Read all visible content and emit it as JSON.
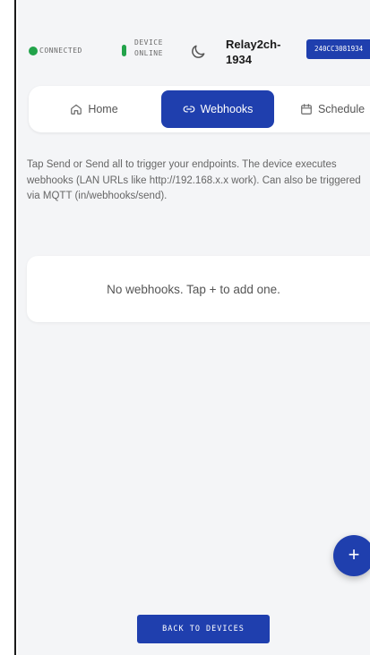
{
  "status": {
    "connected_label": "CONNECTED",
    "device_online_line1": "DEVICE",
    "device_online_line2": "ONLINE",
    "device_name_line1": "Relay2ch-",
    "device_name_line2": "1934",
    "device_id": "240CC3081934",
    "theme_icon": "moon-icon"
  },
  "tabs": [
    {
      "label": "Home",
      "icon": "home-icon",
      "active": false
    },
    {
      "label": "Webhooks",
      "icon": "link-icon",
      "active": true
    },
    {
      "label": "Schedule",
      "icon": "calendar-icon",
      "active": false
    }
  ],
  "description": "Tap Send or Send all to trigger your endpoints. The device executes webhooks (LAN URLs like http://192.168.x.x work). Can also be triggered via MQTT (in/webhooks/send).",
  "empty_state": "No webhooks. Tap + to add one.",
  "fab_label": "+",
  "back_button": "BACK TO DEVICES",
  "colors": {
    "accent": "#1f3fae",
    "status_green": "#22a34a",
    "background": "#f4f5f7"
  }
}
